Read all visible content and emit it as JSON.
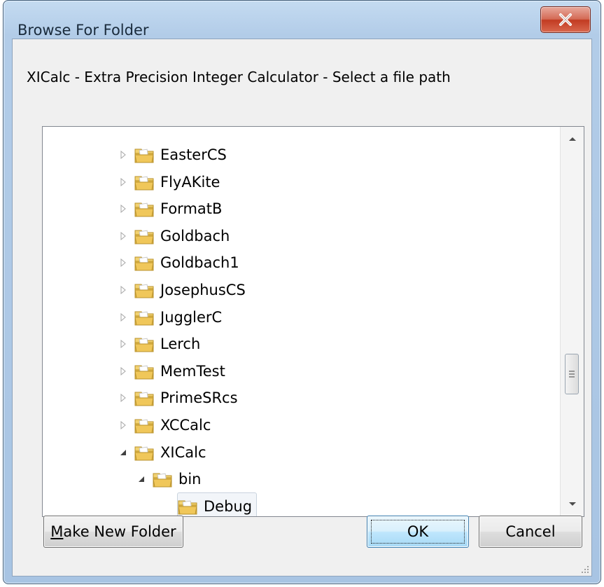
{
  "window": {
    "title": "Browse For Folder",
    "accent": "#a8c4e3",
    "close_color": "#c23b22"
  },
  "dialog": {
    "prompt": "XICalc - Extra Precision Integer Calculator - Select a file path"
  },
  "tree": {
    "items": [
      {
        "label": "EasterCS",
        "expander": "collapsed"
      },
      {
        "label": "FlyAKite",
        "expander": "collapsed"
      },
      {
        "label": "FormatB",
        "expander": "collapsed"
      },
      {
        "label": "Goldbach",
        "expander": "collapsed"
      },
      {
        "label": "Goldbach1",
        "expander": "collapsed"
      },
      {
        "label": "JosephusCS",
        "expander": "collapsed"
      },
      {
        "label": "JugglerC",
        "expander": "collapsed"
      },
      {
        "label": "Lerch",
        "expander": "collapsed"
      },
      {
        "label": "MemTest",
        "expander": "collapsed"
      },
      {
        "label": "PrimeSRcs",
        "expander": "collapsed"
      },
      {
        "label": "XCCalc",
        "expander": "collapsed"
      },
      {
        "label": "XICalc",
        "expander": "expanded"
      },
      {
        "label": "bin",
        "expander": "expanded"
      },
      {
        "label": "Debug",
        "expander": "none",
        "selected": true
      }
    ],
    "icons": {
      "folder": "folder-icon",
      "collapsed": "triangle-right-icon",
      "expanded": "triangle-down-icon"
    }
  },
  "buttons": {
    "make_new_folder_first": "M",
    "make_new_folder_rest": "ake New Folder",
    "ok": "OK",
    "cancel": "Cancel"
  }
}
